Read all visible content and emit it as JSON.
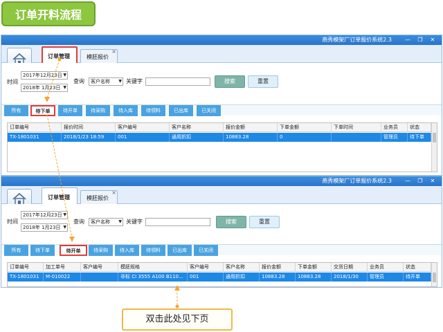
{
  "title_badge": "订单开料流程",
  "app_title": "燕秀模架厂订单报价系统2.3",
  "window_buttons": {
    "minimize": "—",
    "restore": "❐",
    "close": "✕"
  },
  "page_tabs": [
    {
      "label": "订单管理"
    },
    {
      "label": "模胚报价"
    }
  ],
  "search": {
    "time_label": "时间",
    "date_from": "2017年12月23日",
    "date_to_w1": "2018年 1月23日",
    "date_to_w2": "2018年 1月23日",
    "query_label": "查询",
    "field_select": "客户名称",
    "keyword_label": "关键字",
    "search_button": "搜索",
    "reset_button": "重置"
  },
  "filter_tabs": [
    "所有",
    "待下单",
    "待开单",
    "待采购",
    "待入库",
    "待领料",
    "已出库",
    "已关闭"
  ],
  "grid1": {
    "columns": [
      "订单编号",
      "报价时间",
      "客户编号",
      "客户名称",
      "报价金额",
      "下单金额",
      "下单时间",
      "业务员",
      "状态"
    ],
    "rows": [
      [
        "TX-1801031",
        "2018/1/23 18:59",
        "001",
        "通用折扣",
        "10883.28",
        "0",
        "",
        "管理员",
        "待下单"
      ]
    ]
  },
  "grid2": {
    "columns": [
      "订单编号",
      "加工单号",
      "客户编号",
      "模胚规格",
      "客户编号",
      "客户名称",
      "报价金额",
      "下单金额",
      "交货日期",
      "业务员",
      "状态"
    ],
    "rows": [
      [
        "TX-1801031",
        "M-010022",
        "",
        "非标 CI 3555 A100 B110...",
        "001",
        "通用折扣",
        "10883.28",
        "10883.28",
        "2018/1/30",
        "管理员",
        "待开单"
      ]
    ]
  },
  "note": "双击此处见下页",
  "colors": {
    "accent": "#1e88e5",
    "badge": "#8dc63f",
    "highlight": "#e53935",
    "arrow": "#f0a830"
  }
}
